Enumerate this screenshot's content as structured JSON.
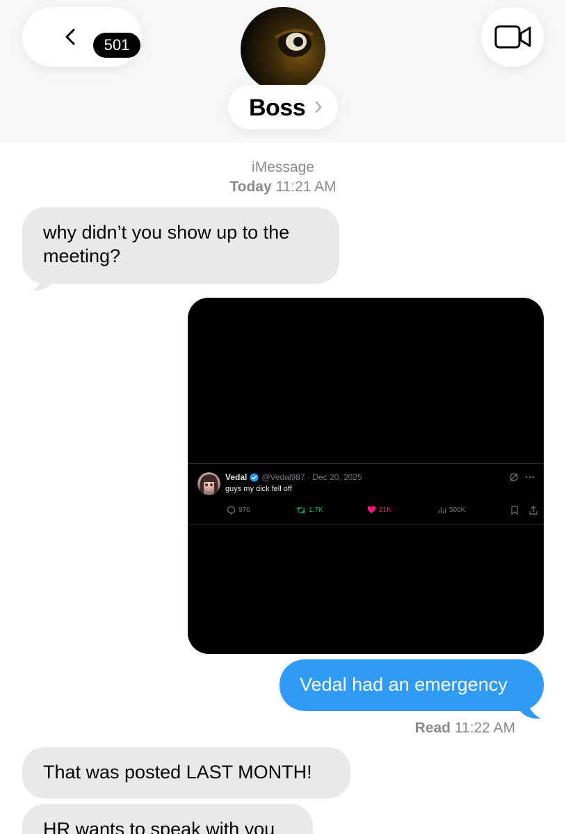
{
  "header": {
    "back_badge": "501",
    "contact_name": "Boss"
  },
  "meta": {
    "service": "iMessage",
    "day": "Today",
    "time": "11:21 AM"
  },
  "messages": [
    {
      "direction": "incoming",
      "text": "why didn’t you show up to the meeting?"
    },
    {
      "direction": "outgoing",
      "text": "Vedal had an emergency"
    },
    {
      "direction": "incoming",
      "text": "That was posted LAST MONTH!"
    },
    {
      "direction": "incoming",
      "text": "HR wants to speak with you"
    }
  ],
  "attachment": {
    "tweet": {
      "name": "Vedal",
      "handle": "@Vedal987",
      "date": "· Dec 20, 2025",
      "text": "guys my dick fell off",
      "replies": "976",
      "retweets": "1.7K",
      "likes": "21K",
      "views": "500K"
    }
  },
  "read_receipt": {
    "label": "Read",
    "time": "11:22 AM"
  },
  "colors": {
    "outgoing_bubble": "#2f9bf6",
    "incoming_bubble": "#e9e9eb",
    "retweet_green": "#00ba7c",
    "like_pink": "#f91880",
    "verified_blue": "#1d9bf0"
  },
  "icons": [
    "back-chevron-icon",
    "video-camera-icon",
    "chevron-right-icon",
    "verified-check-icon",
    "reply-icon",
    "retweet-icon",
    "heart-icon",
    "views-icon",
    "bookmark-icon",
    "share-icon",
    "grok-icon",
    "more-icon"
  ]
}
